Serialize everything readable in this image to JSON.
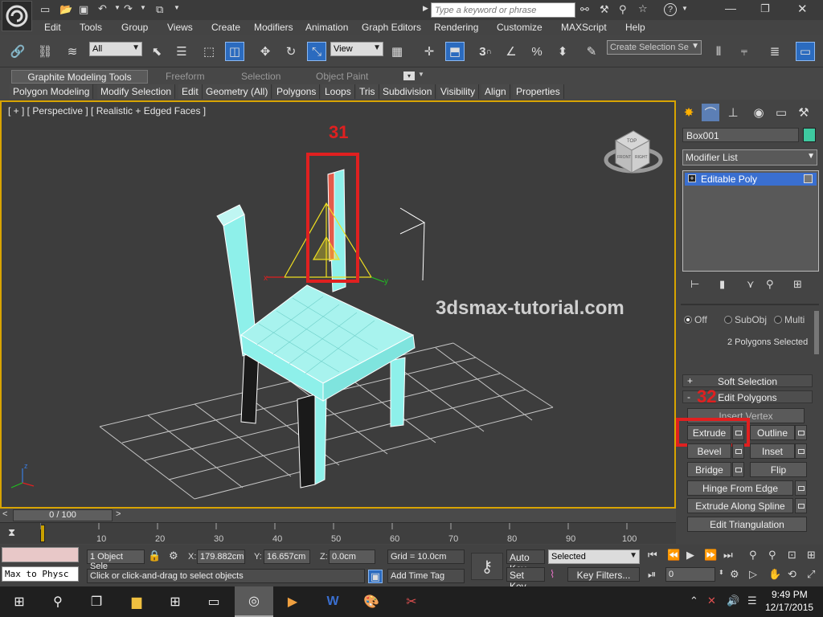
{
  "titlebar": {
    "search_placeholder": "Type a keyword or phrase",
    "help_label": "?"
  },
  "menubar": {
    "items": [
      "Edit",
      "Tools",
      "Group",
      "Views",
      "Create",
      "Modifiers",
      "Animation",
      "Graph Editors",
      "Rendering",
      "Customize",
      "MAXScript",
      "Help"
    ]
  },
  "toolbar": {
    "filter_value": "All",
    "refcoord_value": "View",
    "named_selection_placeholder": "Create Selection Se"
  },
  "ribbon": {
    "tabs": [
      "Graphite Modeling Tools",
      "Freeform",
      "Selection",
      "Object Paint"
    ],
    "panels": [
      "Polygon Modeling",
      "Modify Selection",
      "Edit",
      "Geometry (All)",
      "Polygons",
      "Loops",
      "Tris",
      "Subdivision",
      "Visibility",
      "Align",
      "Properties"
    ]
  },
  "viewport": {
    "label": "[ + ] [ Perspective ] [ Realistic + Edged Faces ]",
    "watermark": "3dsmax-tutorial.com",
    "annotation_31": "31",
    "axis_x": "x",
    "axis_y": "y",
    "axis_z": "z",
    "viewcube_top": "TOP",
    "viewcube_front": "FRONT",
    "viewcube_right": "RIGHT"
  },
  "command_panel": {
    "object_name": "Box001",
    "object_color": "#3ec9a0",
    "modifier_list": "Modifier List",
    "stack_item": "Editable Poly",
    "softsel_off": "Off",
    "softsel_subobj": "SubObj",
    "softsel_multi": "Multi",
    "selection_status": "2 Polygons Selected",
    "rollout_soft": "Soft Selection",
    "rollout_edit_polygons": "Edit Polygons",
    "annotation_32": "32",
    "insert_vertex": "Insert Vertex",
    "extrude": "Extrude",
    "outline": "Outline",
    "bevel": "Bevel",
    "inset": "Inset",
    "bridge": "Bridge",
    "flip": "Flip",
    "hinge": "Hinge From Edge",
    "extrude_spline": "Extrude Along Spline",
    "edit_triangulation": "Edit Triangulation"
  },
  "timeline": {
    "frame_readout": "0 / 100",
    "ticks": [
      "0",
      "10",
      "20",
      "30",
      "40",
      "50",
      "60",
      "70",
      "80",
      "90",
      "100"
    ]
  },
  "status": {
    "maxscript_line": "Max to Physc",
    "objects_selected": "1 Object Sele",
    "prompt": "Click or click-and-drag to select objects",
    "x_label": "X:",
    "x_value": "179.882cm",
    "y_label": "Y:",
    "y_value": "16.657cm",
    "z_label": "Z:",
    "z_value": "0.0cm",
    "grid": "Grid = 10.0cm",
    "add_time_tag": "Add Time Tag",
    "auto_key": "Auto Key",
    "set_key": "Set Key",
    "selected_value": "Selected",
    "key_filters": "Key Filters...",
    "frame_value": "0"
  },
  "taskbar": {
    "time": "9:49 PM",
    "date": "12/17/2015"
  },
  "colors": {
    "highlight_red": "#e02020",
    "selection_blue": "#2b6bbf",
    "mesh_cyan": "#8ef0ea",
    "viewport_border": "#d8a400"
  }
}
